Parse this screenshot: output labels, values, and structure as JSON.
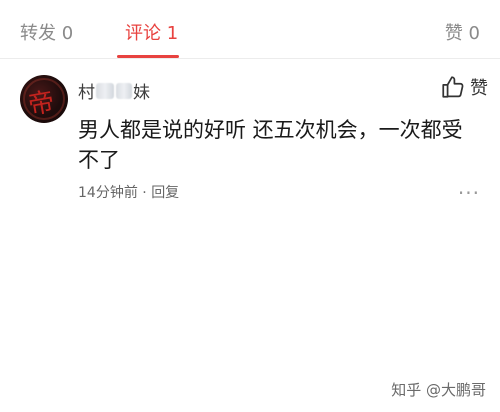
{
  "tabs": {
    "repost": "转发 0",
    "comment": "评论 1",
    "like": "赞 0"
  },
  "comment": {
    "username_left": "村",
    "username_right": "妹",
    "text": "男人都是说的好听 还五次机会，一次都受不了",
    "time": "14分钟前",
    "separator": " · ",
    "reply": "回复",
    "like_label": "赞",
    "more": "···"
  },
  "watermark": "知乎 @大鹏哥",
  "colors": {
    "accent": "#e8423f",
    "tab_inactive": "#8a8a8a"
  }
}
